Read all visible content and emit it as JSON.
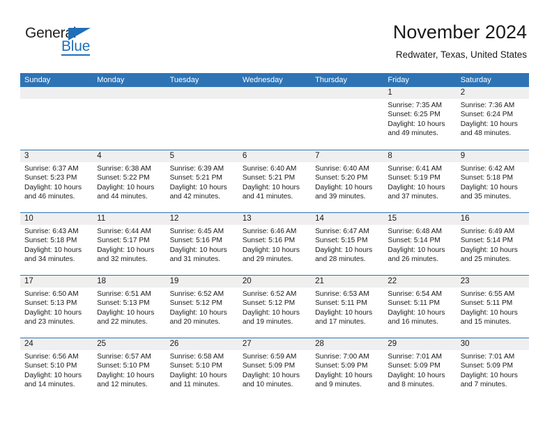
{
  "brand": {
    "name_part1": "General",
    "name_part2": "Blue",
    "accent_color": "#1f6fb8"
  },
  "header": {
    "title": "November 2024",
    "subtitle": "Redwater, Texas, United States"
  },
  "theme": {
    "header_blue": "#2e74b5",
    "day_band_gray": "#efefef",
    "text_color": "#1a1a1a"
  },
  "weekdays": [
    "Sunday",
    "Monday",
    "Tuesday",
    "Wednesday",
    "Thursday",
    "Friday",
    "Saturday"
  ],
  "weeks": [
    [
      {
        "day": "",
        "sunrise": "",
        "sunset": "",
        "daylight1": "",
        "daylight2": ""
      },
      {
        "day": "",
        "sunrise": "",
        "sunset": "",
        "daylight1": "",
        "daylight2": ""
      },
      {
        "day": "",
        "sunrise": "",
        "sunset": "",
        "daylight1": "",
        "daylight2": ""
      },
      {
        "day": "",
        "sunrise": "",
        "sunset": "",
        "daylight1": "",
        "daylight2": ""
      },
      {
        "day": "",
        "sunrise": "",
        "sunset": "",
        "daylight1": "",
        "daylight2": ""
      },
      {
        "day": "1",
        "sunrise": "Sunrise: 7:35 AM",
        "sunset": "Sunset: 6:25 PM",
        "daylight1": "Daylight: 10 hours",
        "daylight2": "and 49 minutes."
      },
      {
        "day": "2",
        "sunrise": "Sunrise: 7:36 AM",
        "sunset": "Sunset: 6:24 PM",
        "daylight1": "Daylight: 10 hours",
        "daylight2": "and 48 minutes."
      }
    ],
    [
      {
        "day": "3",
        "sunrise": "Sunrise: 6:37 AM",
        "sunset": "Sunset: 5:23 PM",
        "daylight1": "Daylight: 10 hours",
        "daylight2": "and 46 minutes."
      },
      {
        "day": "4",
        "sunrise": "Sunrise: 6:38 AM",
        "sunset": "Sunset: 5:22 PM",
        "daylight1": "Daylight: 10 hours",
        "daylight2": "and 44 minutes."
      },
      {
        "day": "5",
        "sunrise": "Sunrise: 6:39 AM",
        "sunset": "Sunset: 5:21 PM",
        "daylight1": "Daylight: 10 hours",
        "daylight2": "and 42 minutes."
      },
      {
        "day": "6",
        "sunrise": "Sunrise: 6:40 AM",
        "sunset": "Sunset: 5:21 PM",
        "daylight1": "Daylight: 10 hours",
        "daylight2": "and 41 minutes."
      },
      {
        "day": "7",
        "sunrise": "Sunrise: 6:40 AM",
        "sunset": "Sunset: 5:20 PM",
        "daylight1": "Daylight: 10 hours",
        "daylight2": "and 39 minutes."
      },
      {
        "day": "8",
        "sunrise": "Sunrise: 6:41 AM",
        "sunset": "Sunset: 5:19 PM",
        "daylight1": "Daylight: 10 hours",
        "daylight2": "and 37 minutes."
      },
      {
        "day": "9",
        "sunrise": "Sunrise: 6:42 AM",
        "sunset": "Sunset: 5:18 PM",
        "daylight1": "Daylight: 10 hours",
        "daylight2": "and 35 minutes."
      }
    ],
    [
      {
        "day": "10",
        "sunrise": "Sunrise: 6:43 AM",
        "sunset": "Sunset: 5:18 PM",
        "daylight1": "Daylight: 10 hours",
        "daylight2": "and 34 minutes."
      },
      {
        "day": "11",
        "sunrise": "Sunrise: 6:44 AM",
        "sunset": "Sunset: 5:17 PM",
        "daylight1": "Daylight: 10 hours",
        "daylight2": "and 32 minutes."
      },
      {
        "day": "12",
        "sunrise": "Sunrise: 6:45 AM",
        "sunset": "Sunset: 5:16 PM",
        "daylight1": "Daylight: 10 hours",
        "daylight2": "and 31 minutes."
      },
      {
        "day": "13",
        "sunrise": "Sunrise: 6:46 AM",
        "sunset": "Sunset: 5:16 PM",
        "daylight1": "Daylight: 10 hours",
        "daylight2": "and 29 minutes."
      },
      {
        "day": "14",
        "sunrise": "Sunrise: 6:47 AM",
        "sunset": "Sunset: 5:15 PM",
        "daylight1": "Daylight: 10 hours",
        "daylight2": "and 28 minutes."
      },
      {
        "day": "15",
        "sunrise": "Sunrise: 6:48 AM",
        "sunset": "Sunset: 5:14 PM",
        "daylight1": "Daylight: 10 hours",
        "daylight2": "and 26 minutes."
      },
      {
        "day": "16",
        "sunrise": "Sunrise: 6:49 AM",
        "sunset": "Sunset: 5:14 PM",
        "daylight1": "Daylight: 10 hours",
        "daylight2": "and 25 minutes."
      }
    ],
    [
      {
        "day": "17",
        "sunrise": "Sunrise: 6:50 AM",
        "sunset": "Sunset: 5:13 PM",
        "daylight1": "Daylight: 10 hours",
        "daylight2": "and 23 minutes."
      },
      {
        "day": "18",
        "sunrise": "Sunrise: 6:51 AM",
        "sunset": "Sunset: 5:13 PM",
        "daylight1": "Daylight: 10 hours",
        "daylight2": "and 22 minutes."
      },
      {
        "day": "19",
        "sunrise": "Sunrise: 6:52 AM",
        "sunset": "Sunset: 5:12 PM",
        "daylight1": "Daylight: 10 hours",
        "daylight2": "and 20 minutes."
      },
      {
        "day": "20",
        "sunrise": "Sunrise: 6:52 AM",
        "sunset": "Sunset: 5:12 PM",
        "daylight1": "Daylight: 10 hours",
        "daylight2": "and 19 minutes."
      },
      {
        "day": "21",
        "sunrise": "Sunrise: 6:53 AM",
        "sunset": "Sunset: 5:11 PM",
        "daylight1": "Daylight: 10 hours",
        "daylight2": "and 17 minutes."
      },
      {
        "day": "22",
        "sunrise": "Sunrise: 6:54 AM",
        "sunset": "Sunset: 5:11 PM",
        "daylight1": "Daylight: 10 hours",
        "daylight2": "and 16 minutes."
      },
      {
        "day": "23",
        "sunrise": "Sunrise: 6:55 AM",
        "sunset": "Sunset: 5:11 PM",
        "daylight1": "Daylight: 10 hours",
        "daylight2": "and 15 minutes."
      }
    ],
    [
      {
        "day": "24",
        "sunrise": "Sunrise: 6:56 AM",
        "sunset": "Sunset: 5:10 PM",
        "daylight1": "Daylight: 10 hours",
        "daylight2": "and 14 minutes."
      },
      {
        "day": "25",
        "sunrise": "Sunrise: 6:57 AM",
        "sunset": "Sunset: 5:10 PM",
        "daylight1": "Daylight: 10 hours",
        "daylight2": "and 12 minutes."
      },
      {
        "day": "26",
        "sunrise": "Sunrise: 6:58 AM",
        "sunset": "Sunset: 5:10 PM",
        "daylight1": "Daylight: 10 hours",
        "daylight2": "and 11 minutes."
      },
      {
        "day": "27",
        "sunrise": "Sunrise: 6:59 AM",
        "sunset": "Sunset: 5:09 PM",
        "daylight1": "Daylight: 10 hours",
        "daylight2": "and 10 minutes."
      },
      {
        "day": "28",
        "sunrise": "Sunrise: 7:00 AM",
        "sunset": "Sunset: 5:09 PM",
        "daylight1": "Daylight: 10 hours",
        "daylight2": "and 9 minutes."
      },
      {
        "day": "29",
        "sunrise": "Sunrise: 7:01 AM",
        "sunset": "Sunset: 5:09 PM",
        "daylight1": "Daylight: 10 hours",
        "daylight2": "and 8 minutes."
      },
      {
        "day": "30",
        "sunrise": "Sunrise: 7:01 AM",
        "sunset": "Sunset: 5:09 PM",
        "daylight1": "Daylight: 10 hours",
        "daylight2": "and 7 minutes."
      }
    ]
  ]
}
